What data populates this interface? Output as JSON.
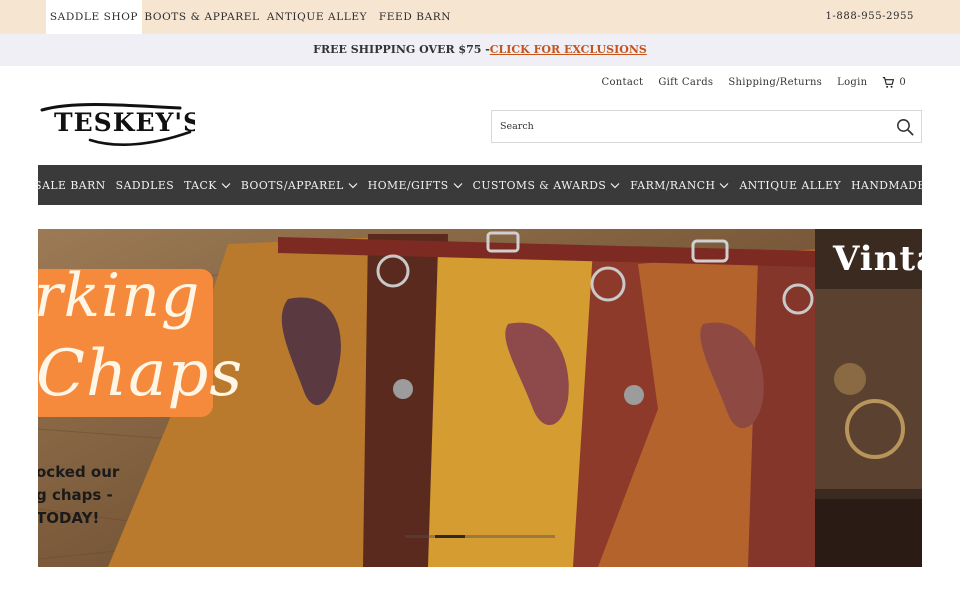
{
  "topbar": {
    "tabs": [
      {
        "label": "SADDLE SHOP",
        "active": true
      },
      {
        "label": "BOOTS & APPAREL",
        "active": false
      },
      {
        "label": "ANTIQUE ALLEY",
        "active": false
      },
      {
        "label": "FEED BARN",
        "active": false
      }
    ],
    "phone": "1-888-955-2955"
  },
  "promo": {
    "text": "FREE SHIPPING OVER $75 -",
    "link": "CLICK FOR EXCLUSIONS",
    "link_color": "#c4541b"
  },
  "utility": {
    "links": [
      "Contact",
      "Gift Cards",
      "Shipping/Returns",
      "Login"
    ],
    "cart_count": "0",
    "cart_icon": "cart-icon"
  },
  "logo": {
    "text": "TESKEY'S"
  },
  "search": {
    "placeholder": "Search",
    "icon": "search-icon"
  },
  "nav": {
    "items": [
      {
        "label": "SALE BARN",
        "dropdown": false
      },
      {
        "label": "SADDLES",
        "dropdown": false
      },
      {
        "label": "TACK",
        "dropdown": true
      },
      {
        "label": "BOOTS/APPAREL",
        "dropdown": true
      },
      {
        "label": "HOME/GIFTS",
        "dropdown": true
      },
      {
        "label": "CUSTOMS & AWARDS",
        "dropdown": true
      },
      {
        "label": "FARM/RANCH",
        "dropdown": true
      },
      {
        "label": "ANTIQUE ALLEY",
        "dropdown": false
      },
      {
        "label": "HANDMADE",
        "dropdown": false
      }
    ],
    "background": "#3a3a3a"
  },
  "hero": {
    "slide1": {
      "title_line1": "rking",
      "title_line2": "Chaps",
      "body_lines": [
        "ocked our",
        "g chaps -",
        "TODAY!"
      ]
    },
    "slide2": {
      "title": "Vinta"
    },
    "slides_total": 5,
    "active_slide": 2
  },
  "colors": {
    "topbar_bg": "#f5e5d1",
    "promo_bg": "#efeff5",
    "nav_bg": "#3a3a3a",
    "hero_orange": "#f58a3c"
  }
}
